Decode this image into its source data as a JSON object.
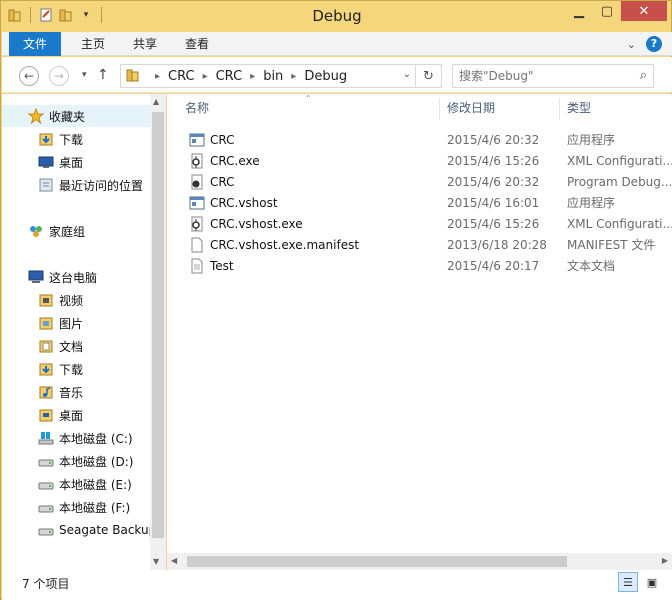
{
  "window": {
    "title": "Debug"
  },
  "ribbon": {
    "tabs": [
      {
        "label": "文件"
      },
      {
        "label": "主页"
      },
      {
        "label": "共享"
      },
      {
        "label": "查看"
      }
    ]
  },
  "address": {
    "crumbs": [
      "CRC",
      "CRC",
      "bin",
      "Debug"
    ],
    "search_placeholder": "搜索\"Debug\""
  },
  "nav": {
    "favorites": "收藏夹",
    "fav_items": [
      "下载",
      "桌面",
      "最近访问的位置"
    ],
    "homegroup": "家庭组",
    "thispc": "这台电脑",
    "pc_items": [
      "视频",
      "图片",
      "文档",
      "下载",
      "音乐",
      "桌面",
      "本地磁盘 (C:)",
      "本地磁盘 (D:)",
      "本地磁盘 (E:)",
      "本地磁盘 (F:)",
      "Seagate Backup"
    ]
  },
  "columns": {
    "name": "名称",
    "date": "修改日期",
    "type": "类型"
  },
  "files": [
    {
      "name": "CRC",
      "date": "2015/4/6 20:32",
      "type": "应用程序",
      "icon": "app-icon"
    },
    {
      "name": "CRC.exe",
      "date": "2015/4/6 15:26",
      "type": "XML Configurati...",
      "icon": "config-icon"
    },
    {
      "name": "CRC",
      "date": "2015/4/6 20:32",
      "type": "Program Debug...",
      "icon": "pdb-icon"
    },
    {
      "name": "CRC.vshost",
      "date": "2015/4/6 16:01",
      "type": "应用程序",
      "icon": "app-icon"
    },
    {
      "name": "CRC.vshost.exe",
      "date": "2015/4/6 15:26",
      "type": "XML Configurati...",
      "icon": "config-icon"
    },
    {
      "name": "CRC.vshost.exe.manifest",
      "date": "2013/6/18 20:28",
      "type": "MANIFEST 文件",
      "icon": "file-icon"
    },
    {
      "name": "Test",
      "date": "2015/4/6 20:17",
      "type": "文本文档",
      "icon": "text-file-icon"
    }
  ],
  "status": {
    "count": "7 个项目"
  },
  "colors": {
    "accent": "#1979ca",
    "titlebar": "#f6d67c",
    "close": "#c7504a"
  }
}
